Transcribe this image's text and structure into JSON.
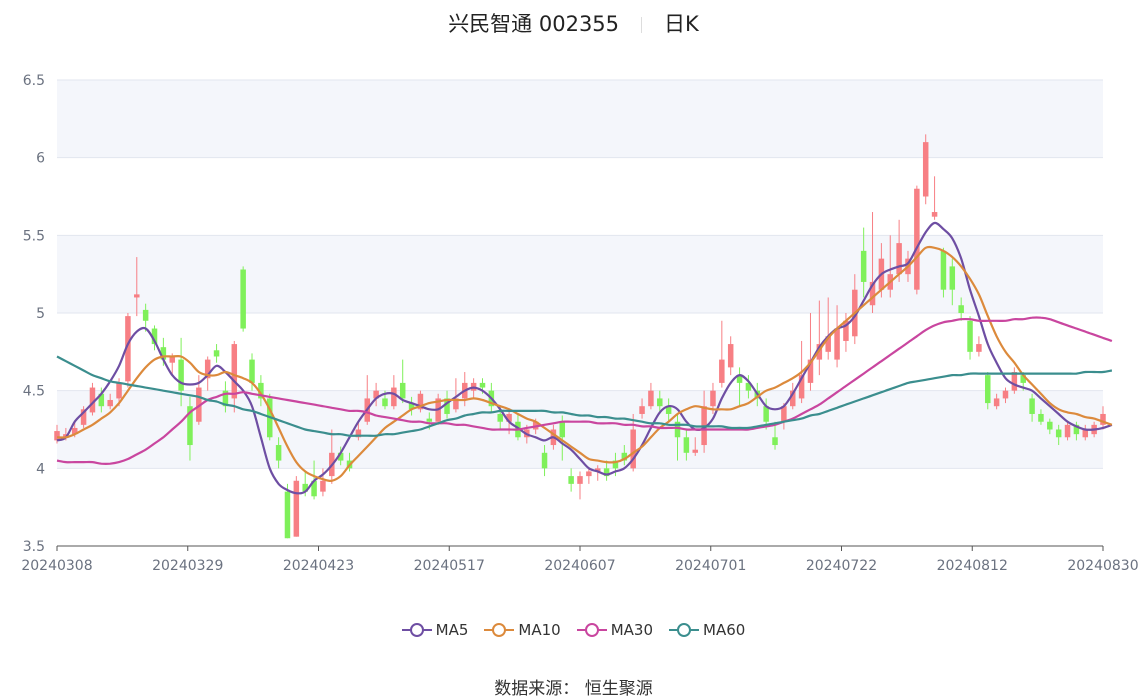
{
  "header": {
    "stock": "兴民智通 002355",
    "period": "日K"
  },
  "source": {
    "label": "数据来源：",
    "name": "恒生聚源"
  },
  "colors": {
    "up": "#f77f84",
    "down": "#7ff05a",
    "MA5": "#6e4ea3",
    "MA10": "#dc8a3c",
    "MA30": "#c9469f",
    "MA60": "#3b8e8e",
    "band": "#f4f6fb",
    "grid": "#e2e6ef",
    "axis": "#6b7280"
  },
  "chart_data": {
    "type": "candlestick",
    "ylim": [
      3.5,
      6.5
    ],
    "yticks": [
      "3.5",
      "4",
      "4.5",
      "5",
      "5.5",
      "6",
      "6.5"
    ],
    "xticks": [
      "20240308",
      "20240329",
      "20240423",
      "20240517",
      "20240607",
      "20240701",
      "20240722",
      "20240812",
      "20240830"
    ],
    "legend": [
      "MA5",
      "MA10",
      "MA30",
      "MA60"
    ],
    "legend_position": "bottom",
    "candles": [
      [
        4.18,
        4.24,
        4.28,
        4.16
      ],
      [
        4.2,
        4.22,
        4.26,
        4.18
      ],
      [
        4.22,
        4.26,
        4.3,
        4.2
      ],
      [
        4.28,
        4.38,
        4.4,
        4.26
      ],
      [
        4.36,
        4.52,
        4.55,
        4.34
      ],
      [
        4.48,
        4.4,
        4.52,
        4.36
      ],
      [
        4.4,
        4.44,
        4.48,
        4.38
      ],
      [
        4.45,
        4.55,
        4.58,
        4.4
      ],
      [
        4.56,
        4.98,
        5.0,
        4.52
      ],
      [
        5.1,
        5.12,
        5.36,
        4.98
      ],
      [
        5.02,
        4.95,
        5.06,
        4.88
      ],
      [
        4.9,
        4.8,
        4.92,
        4.76
      ],
      [
        4.78,
        4.7,
        4.84,
        4.66
      ],
      [
        4.68,
        4.72,
        4.74,
        4.6
      ],
      [
        4.7,
        4.5,
        4.84,
        4.4
      ],
      [
        4.4,
        4.15,
        4.46,
        4.05
      ],
      [
        4.3,
        4.52,
        4.6,
        4.28
      ],
      [
        4.58,
        4.7,
        4.72,
        4.5
      ],
      [
        4.76,
        4.72,
        4.8,
        4.68
      ],
      [
        4.5,
        4.4,
        4.56,
        4.36
      ],
      [
        4.45,
        4.8,
        4.82,
        4.36
      ],
      [
        5.28,
        4.9,
        5.3,
        4.88
      ],
      [
        4.7,
        4.55,
        4.74,
        4.5
      ],
      [
        4.55,
        4.45,
        4.6,
        4.4
      ],
      [
        4.45,
        4.2,
        4.48,
        4.18
      ],
      [
        4.15,
        4.05,
        4.2,
        4.0
      ],
      [
        3.85,
        3.55,
        3.9,
        3.55
      ],
      [
        3.56,
        3.92,
        3.95,
        3.56
      ],
      [
        3.9,
        3.85,
        3.98,
        3.82
      ],
      [
        3.92,
        3.82,
        4.05,
        3.8
      ],
      [
        3.85,
        3.92,
        4.0,
        3.82
      ],
      [
        3.95,
        4.1,
        4.25,
        3.9
      ],
      [
        4.1,
        4.05,
        4.14,
        4.02
      ],
      [
        4.05,
        4.0,
        4.1,
        3.98
      ],
      [
        4.2,
        4.25,
        4.3,
        4.18
      ],
      [
        4.3,
        4.45,
        4.6,
        4.28
      ],
      [
        4.45,
        4.5,
        4.55,
        4.4
      ],
      [
        4.45,
        4.4,
        4.5,
        4.38
      ],
      [
        4.4,
        4.52,
        4.6,
        4.38
      ],
      [
        4.55,
        4.45,
        4.7,
        4.42
      ],
      [
        4.42,
        4.38,
        4.46,
        4.34
      ],
      [
        4.38,
        4.48,
        4.5,
        4.36
      ],
      [
        4.32,
        4.3,
        4.36,
        4.25
      ],
      [
        4.3,
        4.45,
        4.48,
        4.28
      ],
      [
        4.45,
        4.35,
        4.5,
        4.32
      ],
      [
        4.38,
        4.45,
        4.58,
        4.36
      ],
      [
        4.45,
        4.55,
        4.62,
        4.4
      ],
      [
        4.5,
        4.55,
        4.58,
        4.45
      ],
      [
        4.55,
        4.52,
        4.58,
        4.48
      ],
      [
        4.5,
        4.4,
        4.55,
        4.36
      ],
      [
        4.35,
        4.3,
        4.4,
        4.25
      ],
      [
        4.3,
        4.35,
        4.38,
        4.22
      ],
      [
        4.3,
        4.2,
        4.35,
        4.18
      ],
      [
        4.2,
        4.25,
        4.28,
        4.16
      ],
      [
        4.25,
        4.3,
        4.32,
        4.22
      ],
      [
        4.1,
        4.0,
        4.15,
        3.95
      ],
      [
        4.15,
        4.25,
        4.28,
        4.12
      ],
      [
        4.3,
        4.2,
        4.34,
        4.05
      ],
      [
        3.95,
        3.9,
        4.0,
        3.85
      ],
      [
        3.9,
        3.95,
        3.98,
        3.8
      ],
      [
        3.95,
        3.98,
        4.0,
        3.9
      ],
      [
        3.98,
        4.0,
        4.02,
        3.92
      ],
      [
        4.0,
        3.95,
        4.05,
        3.92
      ],
      [
        4.05,
        4.0,
        4.1,
        3.95
      ],
      [
        4.1,
        4.05,
        4.15,
        4.02
      ],
      [
        4.0,
        4.25,
        4.35,
        3.98
      ],
      [
        4.35,
        4.4,
        4.45,
        4.32
      ],
      [
        4.4,
        4.5,
        4.55,
        4.38
      ],
      [
        4.45,
        4.4,
        4.5,
        4.35
      ],
      [
        4.4,
        4.35,
        4.45,
        4.3
      ],
      [
        4.3,
        4.2,
        4.35,
        4.05
      ],
      [
        4.2,
        4.1,
        4.25,
        4.05
      ],
      [
        4.1,
        4.12,
        4.2,
        4.08
      ],
      [
        4.15,
        4.4,
        4.5,
        4.1
      ],
      [
        4.4,
        4.5,
        4.55,
        4.35
      ],
      [
        4.55,
        4.7,
        4.95,
        4.52
      ],
      [
        4.65,
        4.8,
        4.85,
        4.6
      ],
      [
        4.6,
        4.55,
        4.65,
        4.4
      ],
      [
        4.55,
        4.5,
        4.6,
        4.45
      ],
      [
        4.5,
        4.45,
        4.55,
        4.4
      ],
      [
        4.4,
        4.3,
        4.45,
        4.25
      ],
      [
        4.2,
        4.15,
        4.3,
        4.12
      ],
      [
        4.3,
        4.4,
        4.42,
        4.25
      ],
      [
        4.4,
        4.5,
        4.55,
        4.38
      ],
      [
        4.45,
        4.6,
        4.82,
        4.42
      ],
      [
        4.55,
        4.7,
        5.0,
        4.5
      ],
      [
        4.7,
        4.8,
        5.08,
        4.6
      ],
      [
        4.75,
        4.85,
        5.1,
        4.7
      ],
      [
        4.7,
        4.9,
        5.05,
        4.65
      ],
      [
        4.82,
        4.95,
        5.0,
        4.75
      ],
      [
        4.85,
        5.15,
        5.25,
        4.8
      ],
      [
        5.4,
        5.2,
        5.55,
        5.1
      ],
      [
        5.05,
        5.2,
        5.65,
        5.0
      ],
      [
        5.15,
        5.35,
        5.45,
        5.1
      ],
      [
        5.15,
        5.25,
        5.5,
        5.1
      ],
      [
        5.25,
        5.45,
        5.6,
        5.2
      ],
      [
        5.25,
        5.35,
        5.4,
        5.2
      ],
      [
        5.15,
        5.8,
        5.82,
        5.12
      ],
      [
        5.75,
        6.1,
        6.15,
        5.7
      ],
      [
        5.62,
        5.65,
        5.88,
        5.6
      ],
      [
        5.4,
        5.15,
        5.42,
        5.1
      ],
      [
        5.3,
        5.15,
        5.35,
        5.05
      ],
      [
        5.05,
        5.0,
        5.1,
        4.95
      ],
      [
        4.95,
        4.75,
        4.98,
        4.7
      ],
      [
        4.75,
        4.8,
        4.85,
        4.72
      ],
      [
        4.6,
        4.42,
        4.62,
        4.38
      ],
      [
        4.4,
        4.45,
        4.48,
        4.38
      ],
      [
        4.45,
        4.5,
        4.52,
        4.42
      ],
      [
        4.5,
        4.62,
        4.65,
        4.48
      ],
      [
        4.6,
        4.55,
        4.62,
        4.5
      ],
      [
        4.45,
        4.35,
        4.48,
        4.3
      ],
      [
        4.35,
        4.3,
        4.38,
        4.28
      ],
      [
        4.3,
        4.25,
        4.32,
        4.22
      ],
      [
        4.25,
        4.2,
        4.28,
        4.15
      ],
      [
        4.2,
        4.28,
        4.3,
        4.18
      ],
      [
        4.28,
        4.22,
        4.3,
        4.18
      ],
      [
        4.2,
        4.25,
        4.28,
        4.18
      ],
      [
        4.22,
        4.28,
        4.3,
        4.2
      ],
      [
        4.28,
        4.35,
        4.4,
        4.25
      ]
    ],
    "series": [
      {
        "name": "MA5",
        "values": [
          4.18,
          4.2,
          4.3,
          4.36,
          4.42,
          4.48,
          4.56,
          4.66,
          4.8,
          4.88,
          4.9,
          4.82,
          4.7,
          4.6,
          4.55,
          4.54,
          4.55,
          4.6,
          4.66,
          4.62,
          4.56,
          4.5,
          4.4,
          4.2,
          4.0,
          3.9,
          3.86,
          3.84,
          3.85,
          3.92,
          3.96,
          4.02,
          4.1,
          4.2,
          4.3,
          4.38,
          4.45,
          4.48,
          4.48,
          4.44,
          4.42,
          4.4,
          4.38,
          4.38,
          4.42,
          4.46,
          4.5,
          4.52,
          4.5,
          4.45,
          4.38,
          4.3,
          4.26,
          4.22,
          4.2,
          4.18,
          4.2,
          4.16,
          4.12,
          4.06,
          4.0,
          3.98,
          3.96,
          3.98,
          4.0,
          4.06,
          4.15,
          4.26,
          4.36,
          4.4,
          4.38,
          4.3,
          4.25,
          4.26,
          4.32,
          4.45,
          4.55,
          4.6,
          4.56,
          4.48,
          4.4,
          4.38,
          4.4,
          4.48,
          4.58,
          4.68,
          4.78,
          4.85,
          4.9,
          4.92,
          4.98,
          5.08,
          5.18,
          5.25,
          5.28,
          5.3,
          5.32,
          5.42,
          5.52,
          5.58,
          5.54,
          5.48,
          5.35,
          5.15,
          4.98,
          4.8,
          4.68,
          4.58,
          4.54,
          4.52,
          4.5,
          4.45,
          4.4,
          4.35,
          4.3,
          4.27,
          4.25,
          4.25,
          4.26,
          4.28
        ]
      },
      {
        "name": "MA10",
        "values": [
          4.2,
          4.2,
          4.22,
          4.25,
          4.28,
          4.32,
          4.36,
          4.42,
          4.5,
          4.58,
          4.65,
          4.7,
          4.72,
          4.72,
          4.72,
          4.68,
          4.62,
          4.6,
          4.6,
          4.62,
          4.6,
          4.58,
          4.55,
          4.48,
          4.38,
          4.26,
          4.14,
          4.04,
          3.98,
          3.95,
          3.93,
          3.92,
          3.95,
          4.02,
          4.08,
          4.14,
          4.2,
          4.26,
          4.3,
          4.34,
          4.38,
          4.4,
          4.42,
          4.43,
          4.44,
          4.44,
          4.44,
          4.45,
          4.44,
          4.42,
          4.4,
          4.38,
          4.35,
          4.32,
          4.3,
          4.26,
          4.22,
          4.18,
          4.14,
          4.1,
          4.06,
          4.05,
          4.04,
          4.04,
          4.06,
          4.1,
          4.14,
          4.2,
          4.26,
          4.3,
          4.35,
          4.38,
          4.4,
          4.39,
          4.38,
          4.38,
          4.38,
          4.4,
          4.42,
          4.46,
          4.5,
          4.52,
          4.55,
          4.58,
          4.62,
          4.68,
          4.76,
          4.84,
          4.9,
          4.95,
          5.0,
          5.05,
          5.1,
          5.15,
          5.2,
          5.25,
          5.3,
          5.36,
          5.42,
          5.42,
          5.4,
          5.36,
          5.3,
          5.22,
          5.12,
          4.98,
          4.85,
          4.75,
          4.68,
          4.6,
          4.54,
          4.48,
          4.42,
          4.38,
          4.36,
          4.35,
          4.33,
          4.32,
          4.3,
          4.28
        ]
      },
      {
        "name": "MA30",
        "values": [
          4.05,
          4.04,
          4.04,
          4.04,
          4.04,
          4.03,
          4.03,
          4.04,
          4.06,
          4.09,
          4.12,
          4.16,
          4.2,
          4.25,
          4.3,
          4.36,
          4.4,
          4.44,
          4.46,
          4.48,
          4.48,
          4.49,
          4.48,
          4.47,
          4.46,
          4.45,
          4.44,
          4.43,
          4.42,
          4.41,
          4.4,
          4.39,
          4.38,
          4.37,
          4.37,
          4.36,
          4.34,
          4.33,
          4.32,
          4.31,
          4.3,
          4.3,
          4.29,
          4.29,
          4.29,
          4.28,
          4.28,
          4.27,
          4.26,
          4.25,
          4.25,
          4.25,
          4.25,
          4.26,
          4.27,
          4.28,
          4.29,
          4.3,
          4.3,
          4.3,
          4.3,
          4.29,
          4.29,
          4.29,
          4.28,
          4.28,
          4.27,
          4.27,
          4.26,
          4.26,
          4.26,
          4.25,
          4.25,
          4.25,
          4.25,
          4.25,
          4.25,
          4.25,
          4.25,
          4.26,
          4.27,
          4.28,
          4.3,
          4.32,
          4.35,
          4.38,
          4.41,
          4.45,
          4.49,
          4.53,
          4.57,
          4.61,
          4.65,
          4.69,
          4.73,
          4.77,
          4.81,
          4.85,
          4.89,
          4.92,
          4.94,
          4.95,
          4.96,
          4.96,
          4.95,
          4.95,
          4.95,
          4.95,
          4.96,
          4.96,
          4.97,
          4.97,
          4.96,
          4.94,
          4.92,
          4.9,
          4.88,
          4.86,
          4.84,
          4.82
        ]
      },
      {
        "name": "MA60",
        "values": [
          4.72,
          4.69,
          4.66,
          4.63,
          4.6,
          4.58,
          4.56,
          4.55,
          4.54,
          4.53,
          4.52,
          4.51,
          4.5,
          4.49,
          4.48,
          4.47,
          4.46,
          4.44,
          4.43,
          4.41,
          4.4,
          4.38,
          4.37,
          4.35,
          4.33,
          4.31,
          4.29,
          4.27,
          4.25,
          4.24,
          4.23,
          4.22,
          4.22,
          4.21,
          4.21,
          4.21,
          4.21,
          4.22,
          4.22,
          4.23,
          4.24,
          4.25,
          4.27,
          4.29,
          4.31,
          4.32,
          4.34,
          4.35,
          4.36,
          4.36,
          4.37,
          4.37,
          4.37,
          4.37,
          4.37,
          4.37,
          4.36,
          4.36,
          4.35,
          4.34,
          4.34,
          4.33,
          4.33,
          4.32,
          4.32,
          4.31,
          4.3,
          4.29,
          4.29,
          4.28,
          4.28,
          4.28,
          4.27,
          4.27,
          4.27,
          4.27,
          4.26,
          4.26,
          4.26,
          4.27,
          4.28,
          4.29,
          4.3,
          4.31,
          4.32,
          4.34,
          4.35,
          4.37,
          4.39,
          4.41,
          4.43,
          4.45,
          4.47,
          4.49,
          4.51,
          4.53,
          4.55,
          4.56,
          4.57,
          4.58,
          4.59,
          4.6,
          4.6,
          4.61,
          4.61,
          4.61,
          4.61,
          4.61,
          4.61,
          4.61,
          4.61,
          4.61,
          4.61,
          4.61,
          4.61,
          4.61,
          4.62,
          4.62,
          4.62,
          4.63
        ]
      }
    ]
  }
}
